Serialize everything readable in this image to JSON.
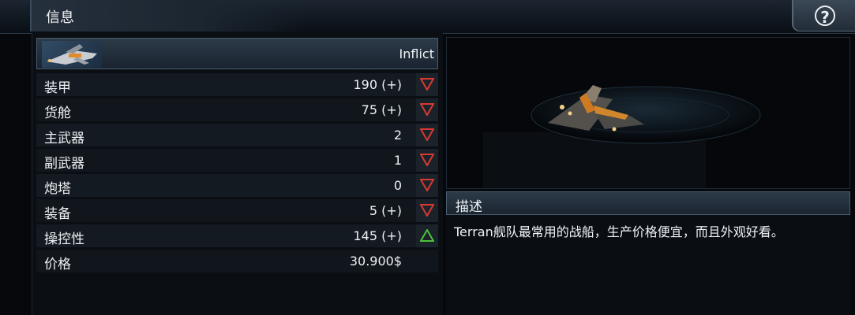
{
  "header": {
    "title": "信息",
    "help_icon": "question-icon",
    "help_symbol": "?"
  },
  "ship": {
    "name": "Inflict"
  },
  "stats": [
    {
      "label": "装甲",
      "value": "190 (+)",
      "trend": "down"
    },
    {
      "label": "货舱",
      "value": "75 (+)",
      "trend": "down"
    },
    {
      "label": "主武器",
      "value": "2",
      "trend": "down"
    },
    {
      "label": "副武器",
      "value": "1",
      "trend": "down"
    },
    {
      "label": "炮塔",
      "value": "0",
      "trend": "down"
    },
    {
      "label": "装备",
      "value": "5 (+)",
      "trend": "down"
    },
    {
      "label": "操控性",
      "value": "145 (+)",
      "trend": "up"
    },
    {
      "label": "价格",
      "value": "30.900$",
      "trend": "none"
    }
  ],
  "description": {
    "title": "描述",
    "text": "Terran舰队最常用的战船，生产价格便宜，而且外观好看。"
  },
  "colors": {
    "down": "#d83a32",
    "up": "#4cc23a",
    "panel": "#141a21",
    "header": "#2c3a48"
  }
}
